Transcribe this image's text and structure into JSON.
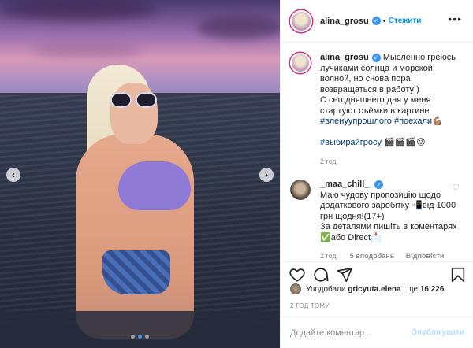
{
  "post": {
    "author": "alina_grosu",
    "separator": "•",
    "follow_label": "Стежити",
    "more_label": "•••"
  },
  "caption": {
    "author": "alina_grosu",
    "text_1": "Мысленно греюсь лучиками солнца и морской волной, но снова пора возвращаться в работу:)",
    "text_2": "С сегодняшнего дня у меня стартуют съёмки в картине",
    "tag_1": "#вленуупрошлого",
    "tag_2": "#поехали",
    "tag_3": "#выбирайгросу",
    "emoji_1": "💪🏽",
    "emoji_2": "🎬🎬🎬😜",
    "time": "2 год."
  },
  "comment": {
    "author": "_maa_chill_",
    "text_1": "Маю чудову пропозицію щодо додаткового заробітку",
    "emoji_phone": "📲",
    "text_2": "від 1000 грн щодня!(17+)",
    "text_3": "За деталями пишіть в коментарях",
    "emoji_check": "✅",
    "text_4": "або Direct",
    "emoji_mail": "📩",
    "time": "2 год.",
    "likes": "5 вподобань",
    "reply": "Відповісти"
  },
  "likes": {
    "prefix": "Уподобали",
    "user": "gricyuta.elena",
    "suffix": "і ще",
    "count": "16 226"
  },
  "time_ago": "2 ГОД ТОМУ",
  "add_comment": {
    "placeholder": "Додайте коментар...",
    "publish_label": "Опублікувати"
  },
  "icons": [
    "heart-icon",
    "comment-icon",
    "share-icon",
    "bookmark-icon",
    "verified-icon"
  ],
  "colors": {
    "link": "#0095f6",
    "verified": "#3897f0",
    "publish_disabled": "#b2dffc",
    "muted": "#8e8e8e"
  }
}
